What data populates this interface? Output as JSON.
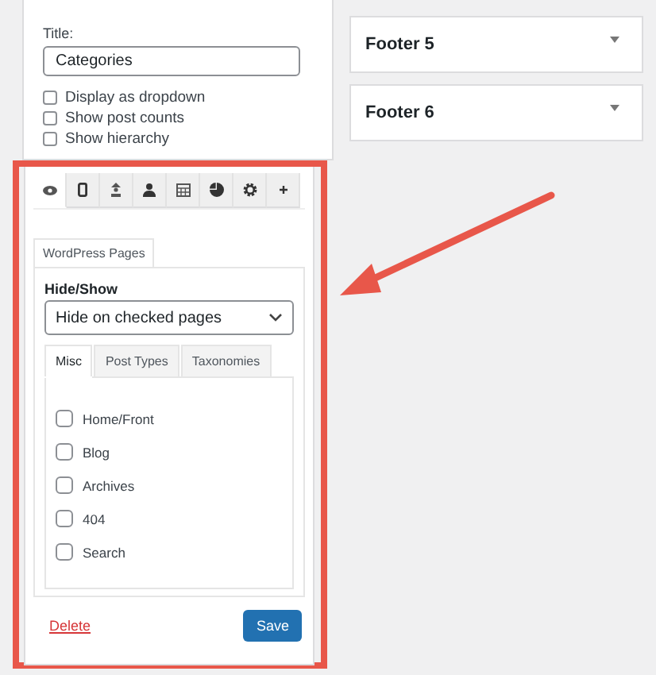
{
  "widget": {
    "title_label": "Title:",
    "title_value": "Categories",
    "options": [
      {
        "label": "Display as dropdown",
        "checked": false
      },
      {
        "label": "Show post counts",
        "checked": false
      },
      {
        "label": "Show hierarchy",
        "checked": false
      }
    ]
  },
  "visibility": {
    "icon_tabs": [
      {
        "kind": "eye",
        "selected": true
      },
      {
        "kind": "phone",
        "selected": false
      },
      {
        "kind": "person-up",
        "selected": false
      },
      {
        "kind": "person",
        "selected": false
      },
      {
        "kind": "calendar",
        "selected": false
      },
      {
        "kind": "pie",
        "selected": false
      },
      {
        "kind": "gear",
        "selected": false
      },
      {
        "kind": "plus",
        "selected": false
      }
    ],
    "section_tab": "WordPress Pages",
    "hide_show_label": "Hide/Show",
    "hide_show_value": "Hide on checked pages",
    "sub_tabs": [
      {
        "label": "Misc",
        "selected": true
      },
      {
        "label": "Post Types",
        "selected": false
      },
      {
        "label": "Taxonomies",
        "selected": false
      }
    ],
    "pages": [
      {
        "label": "Home/Front",
        "checked": false
      },
      {
        "label": "Blog",
        "checked": false
      },
      {
        "label": "Archives",
        "checked": false
      },
      {
        "label": "404",
        "checked": false
      },
      {
        "label": "Search",
        "checked": false
      }
    ],
    "delete": "Delete",
    "save": "Save"
  },
  "sidebars": [
    {
      "title": "Footer 5"
    },
    {
      "title": "Footer 6"
    }
  ]
}
